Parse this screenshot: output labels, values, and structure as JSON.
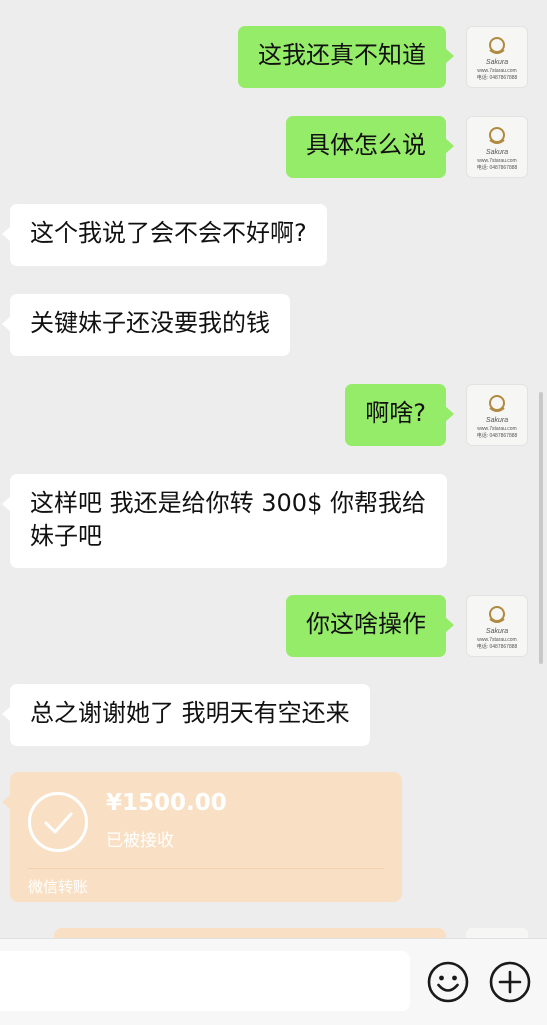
{
  "messages": [
    {
      "side": "right",
      "text": "这我还真不知道"
    },
    {
      "side": "right",
      "text": "具体怎么说"
    },
    {
      "side": "left",
      "text": "这个我说了会不会不好啊?"
    },
    {
      "side": "left",
      "text": "关键妹子还没要我的钱"
    },
    {
      "side": "right",
      "text": "啊啥?"
    },
    {
      "side": "left",
      "text": "这样吧 我还是给你转 300$ 你帮我给妹子吧"
    },
    {
      "side": "right",
      "text": "你这啥操作"
    },
    {
      "side": "left",
      "text": "总之谢谢她了 我明天有空还来"
    }
  ],
  "avatar": {
    "brand": "Sakura",
    "website": "www.7starau.com",
    "phone": "电话: 0487867888"
  },
  "transfer": {
    "amount": "¥1500.00",
    "status": "已被接收",
    "label": "微信转账"
  },
  "input_bar": {
    "emoji_icon": "emoji-icon",
    "add_icon": "plus-circle-icon"
  },
  "colors": {
    "background": "#ededed",
    "sent_bubble": "#95ec69",
    "received_bubble": "#ffffff",
    "transfer_card": "#f9e0c4"
  }
}
